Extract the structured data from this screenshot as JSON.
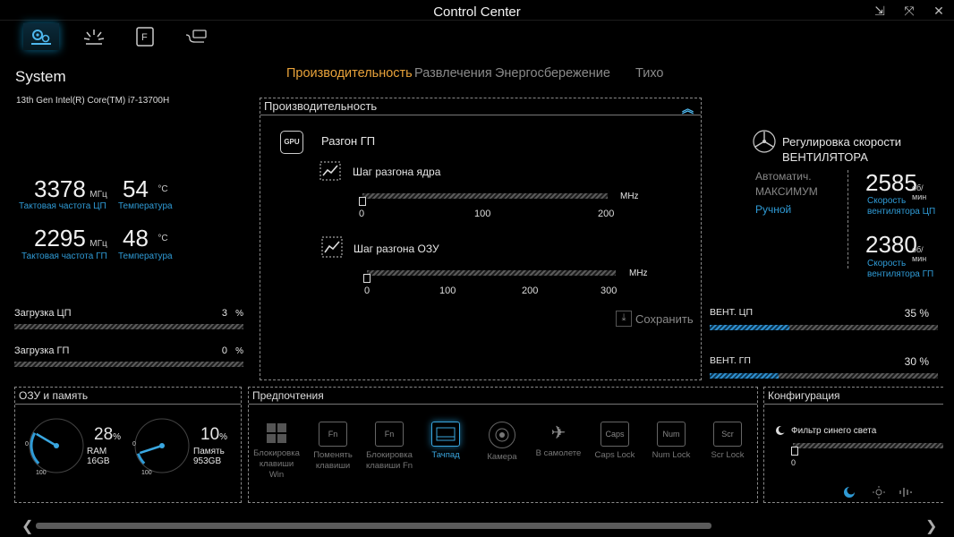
{
  "window": {
    "title": "Control Center",
    "btn_compact": "⇲",
    "btn_full": "⤧",
    "btn_close": "✕"
  },
  "modes": {
    "items": [
      "Производительность",
      "Развлечения",
      "Энергосбережение",
      "Тихо"
    ],
    "active": 0
  },
  "system": {
    "heading": "System",
    "cpu_name": "13th Gen Intel(R) Core(TM) i7-13700H",
    "cpu_freq": {
      "value": "3378",
      "unit": "МГц",
      "label": "Тактовая частота ЦП"
    },
    "cpu_temp": {
      "value": "54",
      "unit": "°C",
      "label": "Температура"
    },
    "gpu_freq": {
      "value": "2295",
      "unit": "МГц",
      "label": "Тактовая частота ГП"
    },
    "gpu_temp": {
      "value": "48",
      "unit": "°C",
      "label": "Температура"
    },
    "cpu_load": {
      "label": "Загрузка ЦП",
      "value": "3",
      "unit": "%"
    },
    "gpu_load": {
      "label": "Загрузка ГП",
      "value": "0",
      "unit": "%"
    }
  },
  "perf_panel": {
    "title": "Производительность",
    "gpu_icon": "GPU",
    "gpu_oc": "Разгон ГП",
    "core": {
      "label": "Шаг разгона ядра",
      "unit": "MHz",
      "ticks": [
        "0",
        "100",
        "200"
      ],
      "value": 0,
      "max": 200
    },
    "mem": {
      "label": "Шаг разгона ОЗУ",
      "unit": "MHz",
      "ticks": [
        "0",
        "100",
        "200",
        "300"
      ],
      "value": 0,
      "max": 300
    },
    "save": "Сохранить"
  },
  "fan": {
    "title_line1": "Регулировка скорости",
    "title_line2": "ВЕНТИЛЯТОРА",
    "modes": [
      "Автоматич.",
      "МАКСИМУМ",
      "Ручной"
    ],
    "cpu_speed": {
      "value": "2585",
      "unit": "об/мин",
      "label1": "Скорость",
      "label2": "вентилятора ЦП"
    },
    "gpu_speed": {
      "value": "2380",
      "unit": "об/мин",
      "label1": "Скорость",
      "label2": "вентилятора ГП"
    },
    "cpu_fan": {
      "label": "ВЕНТ. ЦП",
      "value": "35 %",
      "percent": 35
    },
    "gpu_fan": {
      "label": "ВЕНТ. ГП",
      "value": "30 %",
      "percent": 30
    }
  },
  "memory": {
    "title": "ОЗУ и память",
    "ram": {
      "value": "28",
      "unit": "%",
      "name": "RAM",
      "size": "16GB",
      "percent": 28
    },
    "disk": {
      "value": "10",
      "unit": "%",
      "name": "Память",
      "size": "953GB",
      "percent": 10
    },
    "gauge_min": "0",
    "gauge_max": "100"
  },
  "preferences": {
    "title": "Предпочтения",
    "items": [
      {
        "l1": "Блокировка",
        "l2": "клавиши Win",
        "icon": "windows-key-icon"
      },
      {
        "l1": "Поменять",
        "l2": "клавиши",
        "icon": "swap-keys-icon",
        "glyph": "Fn"
      },
      {
        "l1": "Блокировка",
        "l2": "клавиши Fn",
        "icon": "fn-lock-icon",
        "glyph": "Fn"
      },
      {
        "l1": "Тачпад",
        "l2": "",
        "icon": "touchpad-icon"
      },
      {
        "l1": "Камера",
        "l2": "",
        "icon": "camera-icon"
      },
      {
        "l1": "В самолете",
        "l2": "",
        "icon": "airplane-icon",
        "glyph": "✈"
      },
      {
        "l1": "Caps Lock",
        "l2": "",
        "icon": "caps-lock-icon",
        "glyph": "Caps"
      },
      {
        "l1": "Num Lock",
        "l2": "",
        "icon": "num-lock-icon",
        "glyph": "Num"
      },
      {
        "l1": "Scr Lock",
        "l2": "",
        "icon": "scroll-lock-icon",
        "glyph": "Scr"
      }
    ]
  },
  "config": {
    "title": "Конфигурация",
    "blue_filter": "Фильтр синего света",
    "blue_filter_value": "0"
  },
  "colors": {
    "accent": "#2f9bd6",
    "mode_active": "#e8a23a",
    "mode_inactive": "#8a8a8a"
  }
}
